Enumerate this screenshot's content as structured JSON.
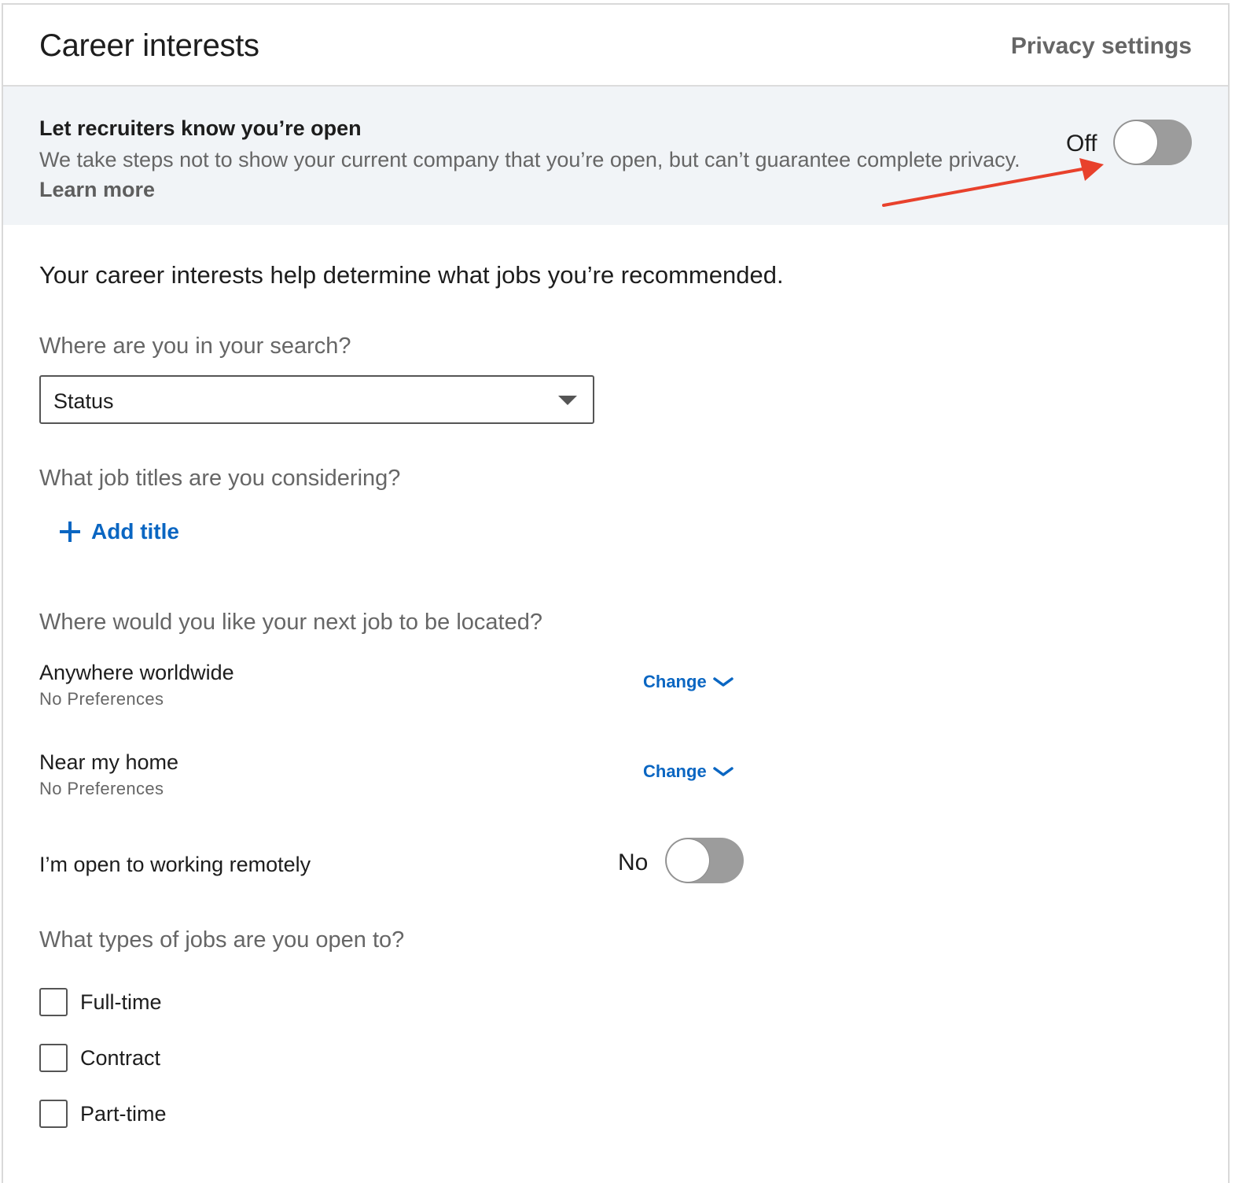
{
  "header": {
    "title": "Career interests",
    "privacy_link": "Privacy settings"
  },
  "recruiter_banner": {
    "heading": "Let recruiters know you’re open",
    "description": "We take steps not to show your current company that you’re open, but can’t guarantee complete privacy.",
    "learn_more": "Learn more",
    "toggle_label": "Off",
    "toggle_on": false
  },
  "intro_text": "Your career interests help determine what jobs you’re recommended.",
  "search_status": {
    "question": "Where are you in your search?",
    "select_value": "Status"
  },
  "job_titles": {
    "question": "What job titles are you considering?",
    "add_label": "Add title"
  },
  "location": {
    "question": "Where would you like your next job to be located?",
    "options": [
      {
        "title": "Anywhere worldwide",
        "subtitle": "No Preferences",
        "action": "Change"
      },
      {
        "title": "Near my home",
        "subtitle": "No Preferences",
        "action": "Change"
      }
    ]
  },
  "remote": {
    "label": "I’m open to working remotely",
    "toggle_label": "No",
    "toggle_on": false
  },
  "job_types": {
    "question": "What types of jobs are you open to?",
    "options": [
      {
        "label": "Full-time",
        "checked": false
      },
      {
        "label": "Contract",
        "checked": false
      },
      {
        "label": "Part-time",
        "checked": false
      }
    ]
  },
  "colors": {
    "link_blue": "#0a66c2",
    "banner_bg": "#f1f4f7",
    "toggle_off": "#9c9c9c",
    "annotation_arrow": "#e8412c"
  },
  "icons": {
    "dropdown": "caret-down-icon",
    "add": "plus-icon",
    "change": "chevron-down-icon"
  }
}
